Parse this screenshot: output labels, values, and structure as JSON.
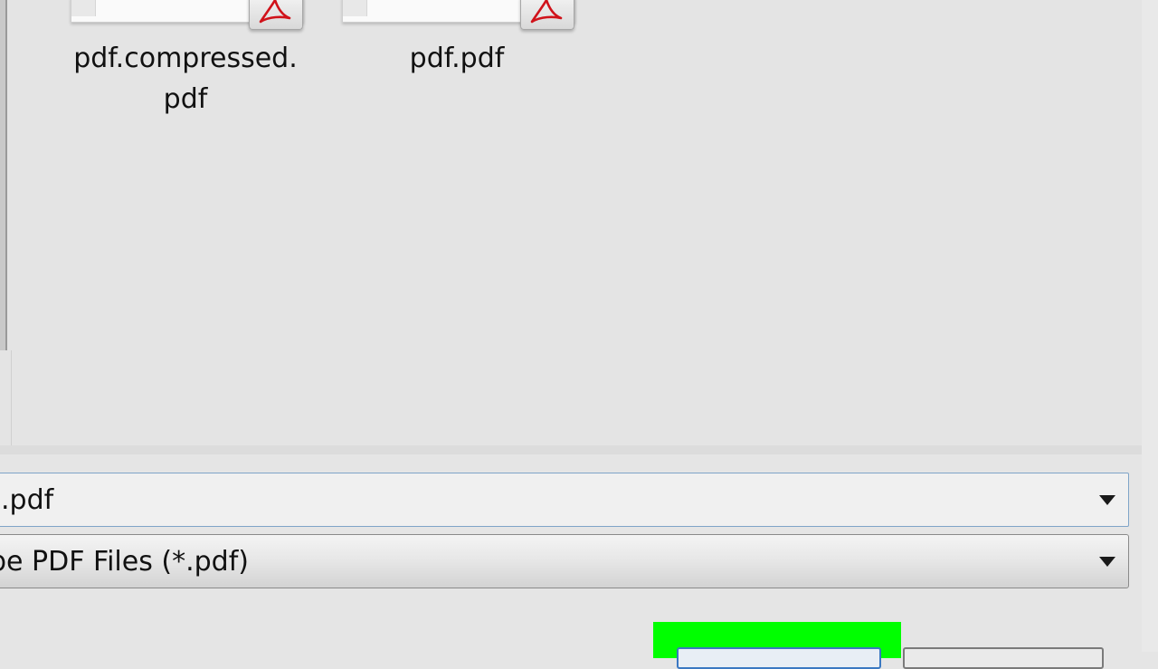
{
  "files": [
    {
      "name_line1": "pdf.compressed.",
      "name_line2": "pdf",
      "icon": "acrobat-pdf-icon"
    },
    {
      "name_line1": "pdf.pdf",
      "name_line2": "",
      "icon": "acrobat-pdf-icon"
    }
  ],
  "file_name_field": {
    "value": ".pdf"
  },
  "file_type_field": {
    "value": "be PDF Files (*.pdf)"
  },
  "colors": {
    "highlight": "#00ff00",
    "acrobat_red": "#d0121a",
    "focus_border": "#7fa4c8"
  }
}
